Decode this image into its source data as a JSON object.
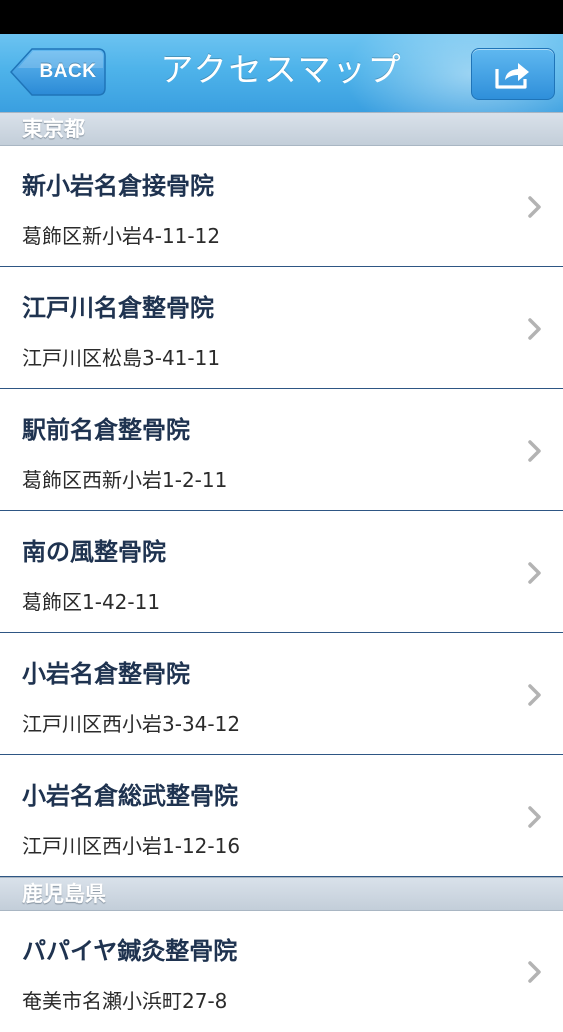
{
  "nav": {
    "back_label": "BACK",
    "title": "アクセスマップ",
    "share_icon": "share-icon"
  },
  "sections": [
    {
      "header": "東京都",
      "items": [
        {
          "name": "新小岩名倉接骨院",
          "address": "葛飾区新小岩4-11-12"
        },
        {
          "name": "江戸川名倉整骨院",
          "address": "江戸川区松島3-41-11"
        },
        {
          "name": "駅前名倉整骨院",
          "address": "葛飾区西新小岩1-2-11"
        },
        {
          "name": "南の風整骨院",
          "address": "葛飾区1-42-11"
        },
        {
          "name": "小岩名倉整骨院",
          "address": "江戸川区西小岩3-34-12"
        },
        {
          "name": "小岩名倉総武整骨院",
          "address": "江戸川区西小岩1-12-16"
        }
      ]
    },
    {
      "header": "鹿児島県",
      "items": [
        {
          "name": "パパイヤ鍼灸整骨院",
          "address": "奄美市名瀬小浜町27-8"
        }
      ]
    }
  ],
  "colors": {
    "nav_blue": "#4eb3ea",
    "row_text": "#1f3350",
    "separator": "#2e5684",
    "section_bg": "#c9d3dd"
  }
}
